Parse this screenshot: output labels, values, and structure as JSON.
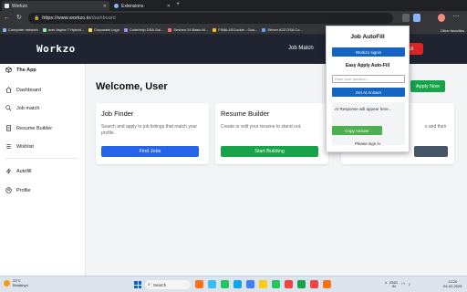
{
  "browser": {
    "tabs": [
      {
        "title": "Workzo",
        "active": true,
        "favicon_color": "#e8eaed"
      },
      {
        "title": "Extensions",
        "active": false,
        "favicon_color": "#8ab4f8"
      }
    ],
    "new_tab_glyph": "+",
    "address": {
      "domain": "https://www.workzo.io",
      "path": "/dashboard"
    },
    "bookmarks": [
      {
        "label": "Computer network",
        "color": "#8ab4f8"
      },
      {
        "label": "acer Aspire 7 Hybrid...",
        "color": "#86efac"
      },
      {
        "label": "Corporate Logo",
        "color": "#fde047"
      },
      {
        "label": "CodeHelp DSA Gui...",
        "color": "#a78bfa"
      },
      {
        "label": "Seshen 24 Basic M...",
        "color": "#f87171"
      },
      {
        "label": "FINAL4SCookie - Goo...",
        "color": "#fbbf24"
      },
      {
        "label": "Striver A2Z DSA Co...",
        "color": "#60a5fa"
      }
    ],
    "other_bookmarks": "Other favorites"
  },
  "site": {
    "brand": "Workzo",
    "nav_job_match": "Job Match",
    "logout_label": "out",
    "accent_dark": "#1f2430"
  },
  "sidebar": {
    "app_label": "The App",
    "items": [
      {
        "label": "Dashboard",
        "icon": "home-icon"
      },
      {
        "label": "Job match",
        "icon": "search-icon"
      },
      {
        "label": "Resume Builder",
        "icon": "document-icon"
      },
      {
        "label": "Wishlist",
        "icon": "list-icon"
      },
      {
        "label": "Autofill",
        "icon": "bolt-icon"
      },
      {
        "label": "Profile",
        "icon": "user-icon"
      }
    ]
  },
  "main": {
    "welcome": "Welcome, User",
    "apply_now": "Apply Now",
    "cards": [
      {
        "title": "Job Finder",
        "description": "Search and apply to job listings that match your profile.",
        "button": "Find Jobs",
        "button_color": "#2563eb"
      },
      {
        "title": "Resume Builder",
        "description": "Create or edit your resume to stand out.",
        "button": "Start Building",
        "button_color": "#16a34a"
      },
      {
        "title": "",
        "description": "s and their",
        "button": "",
        "button_color": "#475569"
      }
    ]
  },
  "popup": {
    "title": "Job AutoFill",
    "signin_button": "Workzo signin",
    "easy_apply_label": "Easy Apply Auto-Fill",
    "question_placeholder": "Enter your question...",
    "get_answer": "Get AI Answer",
    "response_placeholder": "AI Response will appear here...",
    "copy_answer": "Copy Answer",
    "please_sign_in": "Please sign in",
    "blue": "#1565c0",
    "green": "#4caf50"
  },
  "taskbar": {
    "weather_temp": "23°C",
    "weather_desc": "Bhidbhyd",
    "search_label": "Search",
    "lang_line1": "ENG",
    "lang_line2": "IN",
    "time": "13:20",
    "date": "04-02-2025",
    "pinned_apps": [
      "#f97316",
      "#38bdf8",
      "#22c55e",
      "#0ea5e9",
      "#3b82f6",
      "#facc15",
      "#22c55e",
      "#ef4444",
      "#16a34a",
      "#ef4444",
      "#f97316"
    ]
  }
}
